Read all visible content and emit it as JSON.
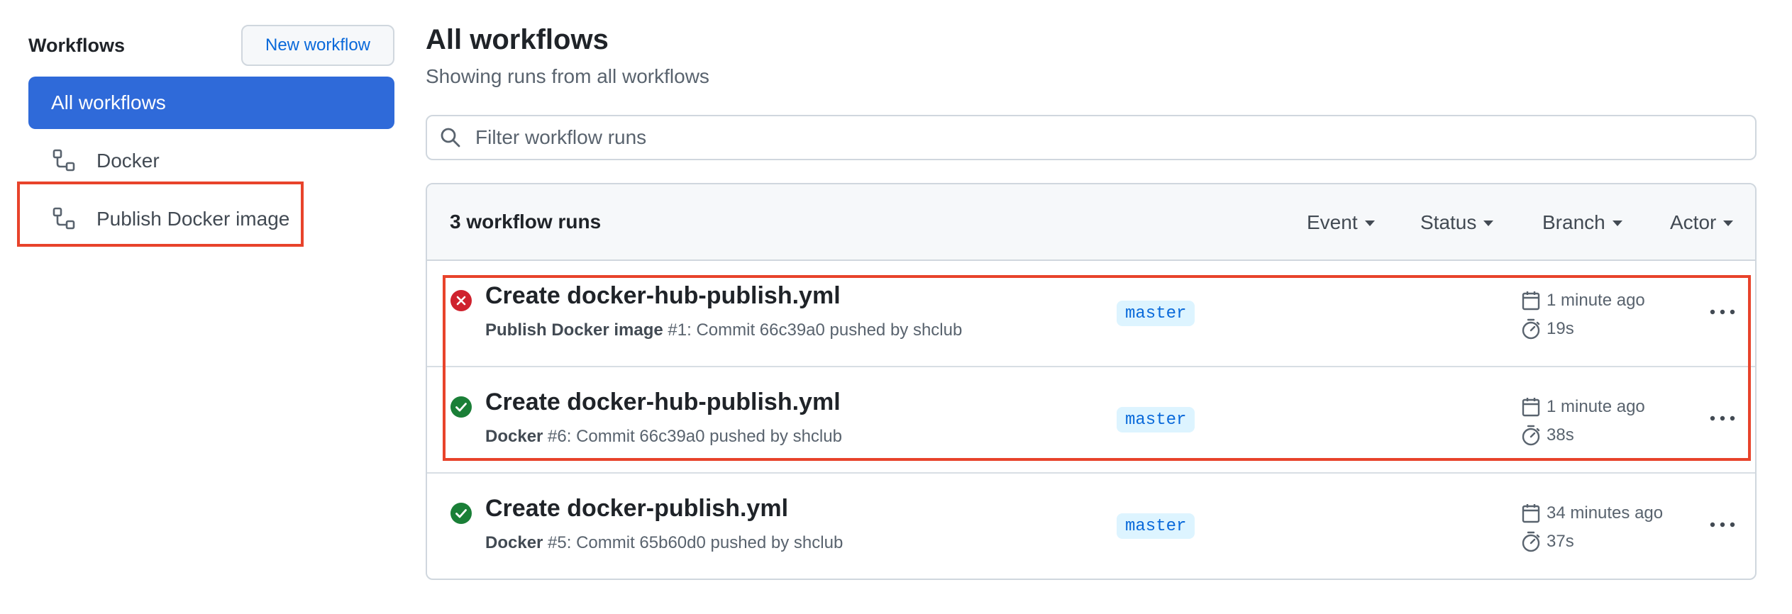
{
  "sidebar": {
    "title": "Workflows",
    "new_workflow_label": "New workflow",
    "all_workflows_label": "All workflows",
    "items": [
      {
        "label": "Docker",
        "icon": "workflow-icon"
      },
      {
        "label": "Publish Docker image",
        "icon": "workflow-icon"
      }
    ]
  },
  "main": {
    "title": "All workflows",
    "subtitle": "Showing runs from all workflows",
    "search": {
      "placeholder": "Filter workflow runs",
      "value": "",
      "icon": "search-icon"
    },
    "runs_count": "3 workflow runs",
    "filters": [
      "Event",
      "Status",
      "Branch",
      "Actor"
    ],
    "runs": [
      {
        "status": "failure",
        "title": "Create docker-hub-publish.yml",
        "workflow": "Publish Docker image",
        "meta_rest": " #1: Commit 66c39a0 pushed by shclub",
        "branch": "master",
        "time": "1 minute ago",
        "duration": "19s"
      },
      {
        "status": "success",
        "title": "Create docker-hub-publish.yml",
        "workflow": "Docker",
        "meta_rest": " #6: Commit 66c39a0 pushed by shclub",
        "branch": "master",
        "time": "1 minute ago",
        "duration": "38s"
      },
      {
        "status": "success",
        "title": "Create docker-publish.yml",
        "workflow": "Docker",
        "meta_rest": " #5: Commit 65b60d0 pushed by shclub",
        "branch": "master",
        "time": "34 minutes ago",
        "duration": "37s"
      }
    ]
  },
  "colors": {
    "accent": "#2f6ad9",
    "link": "#0969da",
    "failure": "#cf222e",
    "success": "#1a7f37",
    "highlight": "#e8432b"
  }
}
